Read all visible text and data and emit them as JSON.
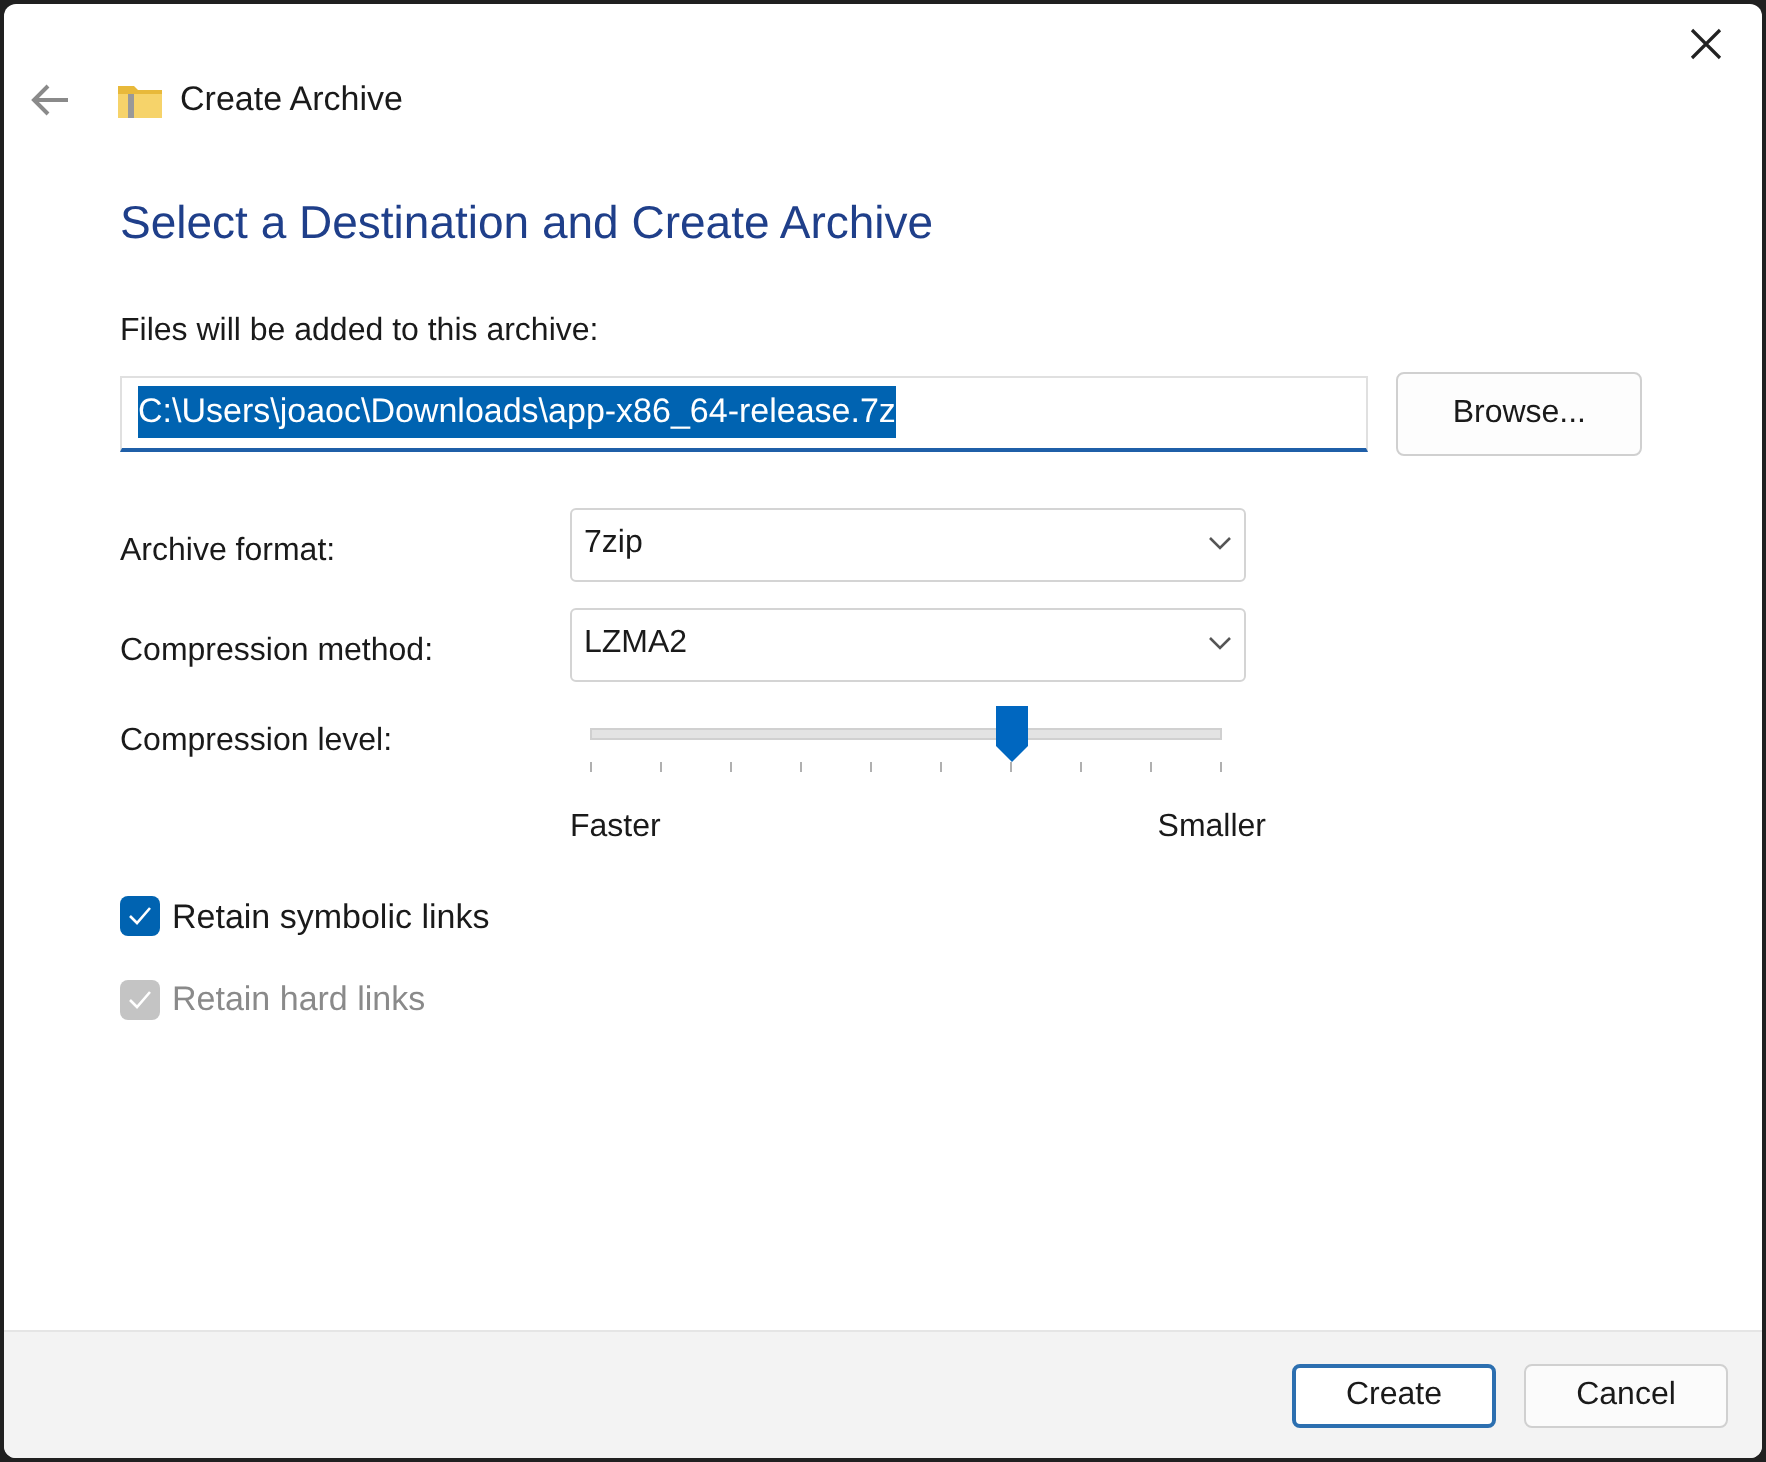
{
  "window": {
    "title": "Create Archive"
  },
  "heading": "Select a Destination and Create Archive",
  "destination": {
    "label": "Files will be added to this archive:",
    "value": "C:\\Users\\joaoc\\Downloads\\app-x86_64-release.7z",
    "selected": true,
    "browse_button": "Browse..."
  },
  "options": [
    {
      "label": "Archive format:",
      "value": "7zip"
    },
    {
      "label": "Compression method:",
      "value": "LZMA2"
    }
  ],
  "compression_level": {
    "label": "Compression level:",
    "level": 0.667,
    "min_label": "Faster",
    "max_label": "Smaller"
  },
  "checkboxes": [
    {
      "label": "Retain symbolic links",
      "checked": true,
      "disabled": false
    },
    {
      "label": "Retain hard links",
      "checked": true,
      "disabled": true
    }
  ],
  "buttons": [
    {
      "label": "Create",
      "default": true
    },
    {
      "label": "Cancel",
      "default": false
    }
  ]
}
